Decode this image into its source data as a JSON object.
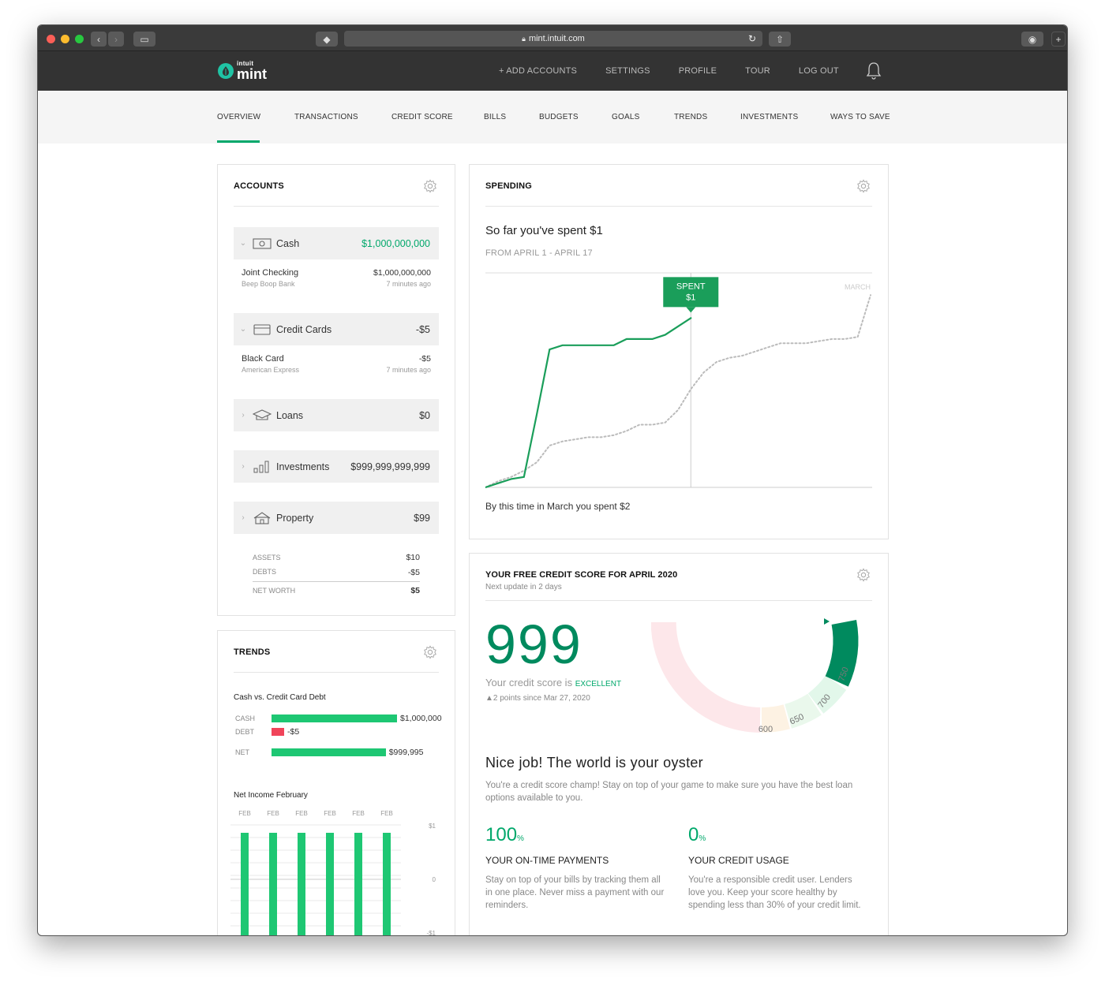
{
  "browser": {
    "url": "mint.intuit.com"
  },
  "brand": {
    "company": "intuit",
    "product": "mint",
    "accent": "#00a86b"
  },
  "header_nav": [
    "+ ADD ACCOUNTS",
    "SETTINGS",
    "PROFILE",
    "TOUR",
    "LOG OUT"
  ],
  "main_nav": {
    "active": "OVERVIEW",
    "items": [
      "OVERVIEW",
      "TRANSACTIONS",
      "CREDIT SCORE",
      "BILLS",
      "BUDGETS",
      "GOALS",
      "TRENDS",
      "INVESTMENTS",
      "WAYS TO SAVE"
    ]
  },
  "accounts": {
    "title": "ACCOUNTS",
    "groups": [
      {
        "name": "Cash",
        "icon": "cash-icon",
        "amount": "$1,000,000,000",
        "expanded": true,
        "sub": {
          "name": "Joint Checking",
          "institution": "Beep Boop Bank",
          "amount": "$1,000,000,000",
          "updated": "7 minutes ago"
        }
      },
      {
        "name": "Credit Cards",
        "icon": "credit-card-icon",
        "amount": "-$5",
        "expanded": true,
        "sub": {
          "name": "Black Card",
          "institution": "American Express",
          "amount": "-$5",
          "updated": "7 minutes ago"
        }
      },
      {
        "name": "Loans",
        "icon": "graduation-cap-icon",
        "amount": "$0",
        "expanded": false
      },
      {
        "name": "Investments",
        "icon": "bar-chart-icon",
        "amount": "$999,999,999,999",
        "expanded": false
      },
      {
        "name": "Property",
        "icon": "house-icon",
        "amount": "$99",
        "expanded": false
      }
    ],
    "summary": {
      "assets_label": "ASSETS",
      "assets": "$10",
      "debts_label": "DEBTS",
      "debts": "-$5",
      "net_worth_label": "NET WORTH",
      "net_worth": "$5"
    }
  },
  "trends": {
    "title": "TRENDS",
    "cash_vs_debt": {
      "title": "Cash vs. Credit Card Debt",
      "rows": [
        {
          "label": "CASH",
          "value": "$1,000,000",
          "fraction": 1.0,
          "color": "#1ec773"
        },
        {
          "label": "DEBT",
          "value": "-$5",
          "fraction": 0.1,
          "color": "#f0445a"
        },
        {
          "label": "NET",
          "value": "$999,995",
          "fraction": 0.91,
          "color": "#1ec773"
        }
      ]
    },
    "net_income": {
      "title": "Net Income February",
      "months": [
        "FEB",
        "FEB",
        "FEB",
        "FEB",
        "FEB",
        "FEB"
      ],
      "values": [
        1,
        1,
        1,
        1,
        1,
        1
      ],
      "y_ticks": [
        "$1",
        "0",
        "-$1"
      ]
    }
  },
  "spending": {
    "title": "SPENDING",
    "headline": "So far you've spent $1",
    "range": "FROM APRIL 1 - APRIL 17",
    "tooltip_line1": "SPENT",
    "tooltip_line2": "$1",
    "compare_label": "MARCH",
    "footer": "By this time in March you spent $2"
  },
  "chart_data": {
    "type": "line",
    "title": "So far you've spent $1",
    "series": [
      {
        "name": "APRIL",
        "color": "#1a9e5a",
        "style": "solid",
        "x": [
          1,
          2,
          3,
          4,
          5,
          6,
          7,
          8,
          9,
          10,
          11,
          12,
          13,
          14,
          15,
          16,
          17
        ],
        "y": [
          0,
          0.02,
          0.04,
          0.05,
          0.35,
          0.66,
          0.68,
          0.68,
          0.68,
          0.68,
          0.68,
          0.71,
          0.71,
          0.71,
          0.73,
          0.77,
          0.81
        ]
      },
      {
        "name": "MARCH",
        "color": "#bbbbbb",
        "style": "dotted",
        "x": [
          1,
          2,
          3,
          4,
          5,
          6,
          7,
          8,
          9,
          10,
          11,
          12,
          13,
          14,
          15,
          16,
          17,
          18,
          19,
          20,
          21,
          22,
          23,
          24,
          25,
          26,
          27,
          28,
          29,
          30,
          31
        ],
        "y": [
          0,
          0.03,
          0.05,
          0.08,
          0.12,
          0.2,
          0.22,
          0.23,
          0.24,
          0.24,
          0.25,
          0.27,
          0.3,
          0.3,
          0.31,
          0.37,
          0.47,
          0.55,
          0.6,
          0.62,
          0.63,
          0.65,
          0.67,
          0.69,
          0.69,
          0.69,
          0.7,
          0.71,
          0.71,
          0.72,
          0.92
        ]
      }
    ],
    "today_x": 17,
    "xlim": [
      1,
      31
    ]
  },
  "credit": {
    "title": "YOUR FREE CREDIT SCORE FOR APRIL 2020",
    "next_update": "Next update in 2 days",
    "score": "999",
    "score_text": "Your credit score is",
    "rating": "EXCELLENT",
    "change": "▲2 points since Mar 27, 2020",
    "gauge_labels": [
      "600",
      "650",
      "700",
      "750"
    ],
    "headline": "Nice job! The world is your oyster",
    "body": "You're a credit score champ! Stay on top of your game to make sure you have the best loan options available to you.",
    "factors": [
      {
        "value": "100",
        "unit": "%",
        "title": "YOUR ON-TIME PAYMENTS",
        "body": "Stay on top of your bills by tracking them all in one place. Never miss a payment with our reminders."
      },
      {
        "value": "0",
        "unit": "%",
        "title": "YOUR CREDIT USAGE",
        "body": "You're a responsible credit user. Lenders love you. Keep your score healthy by spending less than 30% of your credit limit."
      }
    ]
  }
}
